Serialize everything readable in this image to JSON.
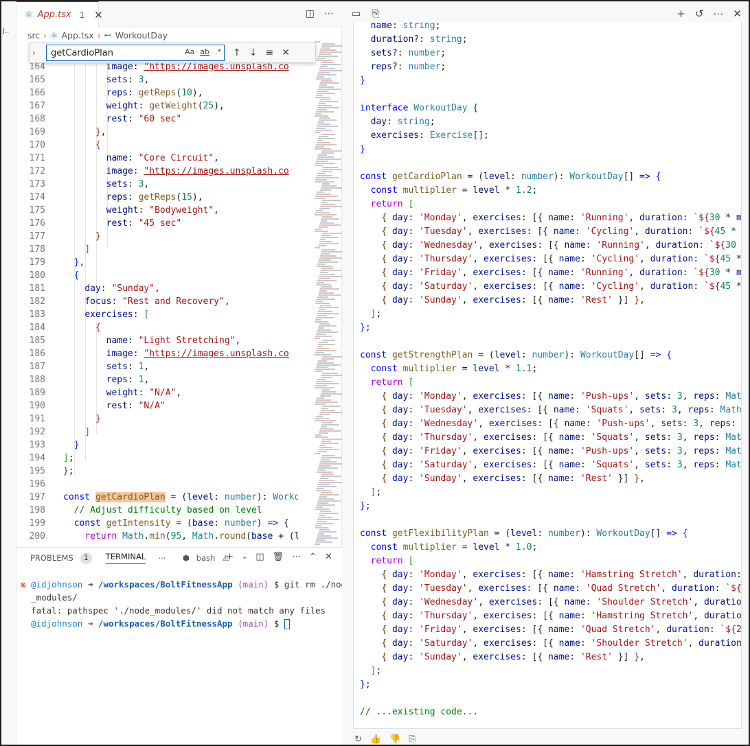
{
  "editor": {
    "tab": {
      "filename": "App.tsx",
      "problems_count": "1"
    },
    "breadcrumb": [
      "src",
      "App.tsx",
      "WorkoutDay"
    ],
    "find": {
      "query": "getCardioPlan",
      "opt_case": "Aa",
      "opt_word": "ab",
      "opt_regex": ".*"
    },
    "lines": [
      {
        "n": "164"
      },
      {
        "n": "165"
      },
      {
        "n": "166"
      },
      {
        "n": "167"
      },
      {
        "n": "168"
      },
      {
        "n": "169"
      },
      {
        "n": "170"
      },
      {
        "n": "171"
      },
      {
        "n": "172"
      },
      {
        "n": "173"
      },
      {
        "n": "174"
      },
      {
        "n": "175"
      },
      {
        "n": "176"
      },
      {
        "n": "177"
      },
      {
        "n": "178"
      },
      {
        "n": "179"
      },
      {
        "n": "180"
      },
      {
        "n": "181"
      },
      {
        "n": "182"
      },
      {
        "n": "183"
      },
      {
        "n": "184"
      },
      {
        "n": "185"
      },
      {
        "n": "186"
      },
      {
        "n": "187"
      },
      {
        "n": "188"
      },
      {
        "n": "189"
      },
      {
        "n": "190"
      },
      {
        "n": "191"
      },
      {
        "n": "192"
      },
      {
        "n": "193"
      },
      {
        "n": "194"
      },
      {
        "n": "195"
      },
      {
        "n": "196"
      },
      {
        "n": "197"
      },
      {
        "n": "198"
      },
      {
        "n": "199"
      },
      {
        "n": "200"
      }
    ]
  },
  "panel": {
    "tabs": {
      "problems": "PROBLEMS",
      "problems_badge": "1",
      "terminal": "TERMINAL",
      "shell": "bash"
    },
    "terminal": {
      "user": "@idjohnson",
      "path": "/workspaces/BoltFitnessApp",
      "branch": "(main)",
      "cmd1a": "$ git rm ./node",
      "cmd1b": "_modules/",
      "error": "fatal: pathspec './node_modules/' did not match any files",
      "prompt2": "$"
    }
  },
  "chat": {
    "icons": [
      "chat-icon",
      "copy-file-icon",
      "plus-icon",
      "history-icon",
      "more-icon",
      "close-icon"
    ],
    "trailing_comment": "// ...existing code..."
  },
  "colors": {
    "accent": "#005fb8",
    "string": "#a31515",
    "keyword": "#0000ff",
    "type": "#267f99",
    "highlight": "#f5c79a"
  }
}
